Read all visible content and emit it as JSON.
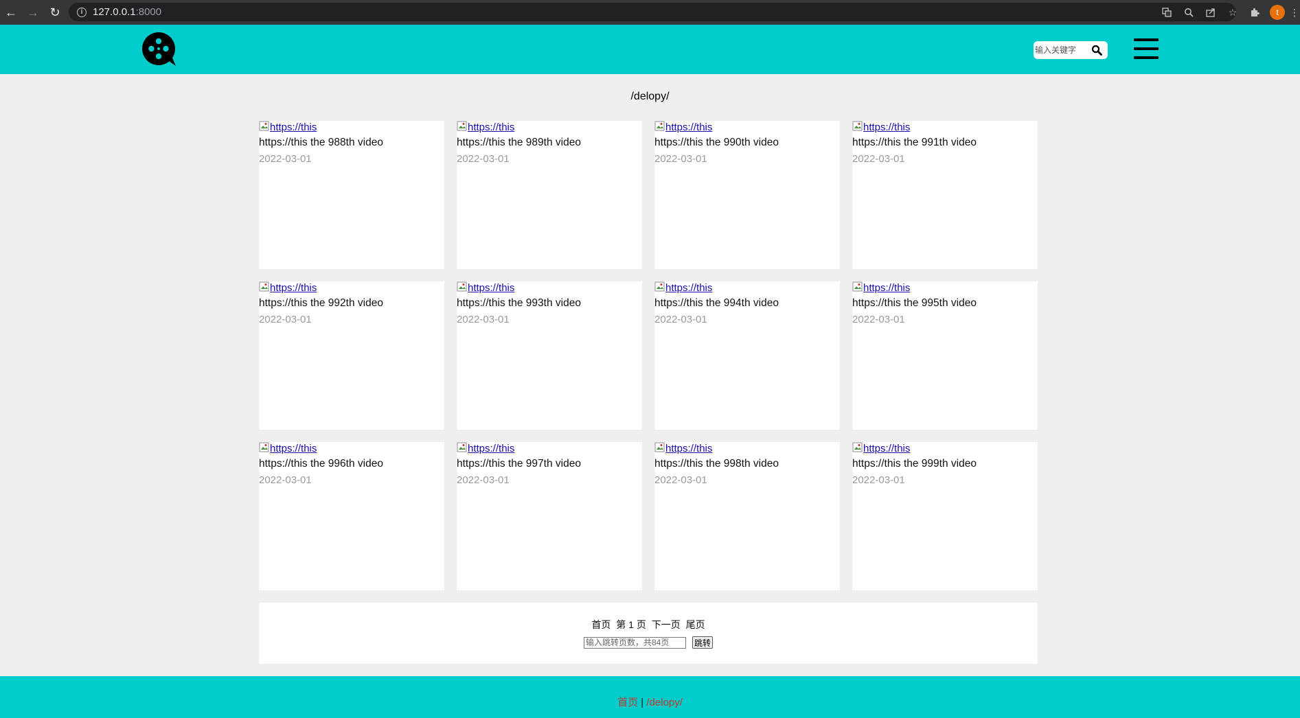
{
  "browser": {
    "url_host": "127.0.0.1",
    "url_port": ":8000",
    "profile_initial": "t"
  },
  "header": {
    "search_placeholder": "输入关键字"
  },
  "page": {
    "path_title": "/delopy/"
  },
  "videos": [
    {
      "thumb_alt": "https://this",
      "title": "https://this the 988th video",
      "date": "2022-03-01"
    },
    {
      "thumb_alt": "https://this",
      "title": "https://this the 989th video",
      "date": "2022-03-01"
    },
    {
      "thumb_alt": "https://this",
      "title": "https://this the 990th video",
      "date": "2022-03-01"
    },
    {
      "thumb_alt": "https://this",
      "title": "https://this the 991th video",
      "date": "2022-03-01"
    },
    {
      "thumb_alt": "https://this",
      "title": "https://this the 992th video",
      "date": "2022-03-01"
    },
    {
      "thumb_alt": "https://this",
      "title": "https://this the 993th video",
      "date": "2022-03-01"
    },
    {
      "thumb_alt": "https://this",
      "title": "https://this the 994th video",
      "date": "2022-03-01"
    },
    {
      "thumb_alt": "https://this",
      "title": "https://this the 995th video",
      "date": "2022-03-01"
    },
    {
      "thumb_alt": "https://this",
      "title": "https://this the 996th video",
      "date": "2022-03-01"
    },
    {
      "thumb_alt": "https://this",
      "title": "https://this the 997th video",
      "date": "2022-03-01"
    },
    {
      "thumb_alt": "https://this",
      "title": "https://this the 998th video",
      "date": "2022-03-01"
    },
    {
      "thumb_alt": "https://this",
      "title": "https://this the 999th video",
      "date": "2022-03-01"
    }
  ],
  "pager": {
    "first": "首页",
    "current": "第 1 页",
    "next": "下一页",
    "last": "尾页",
    "jump_placeholder": "输入跳转页数，共84页",
    "jump_button": "跳转"
  },
  "footer": {
    "home_link": "首页",
    "separator": " | ",
    "path_link": "/delopy/"
  },
  "colors": {
    "brand": "#00cccc",
    "link": "#1a0dab",
    "footer_link": "#c0392b"
  }
}
